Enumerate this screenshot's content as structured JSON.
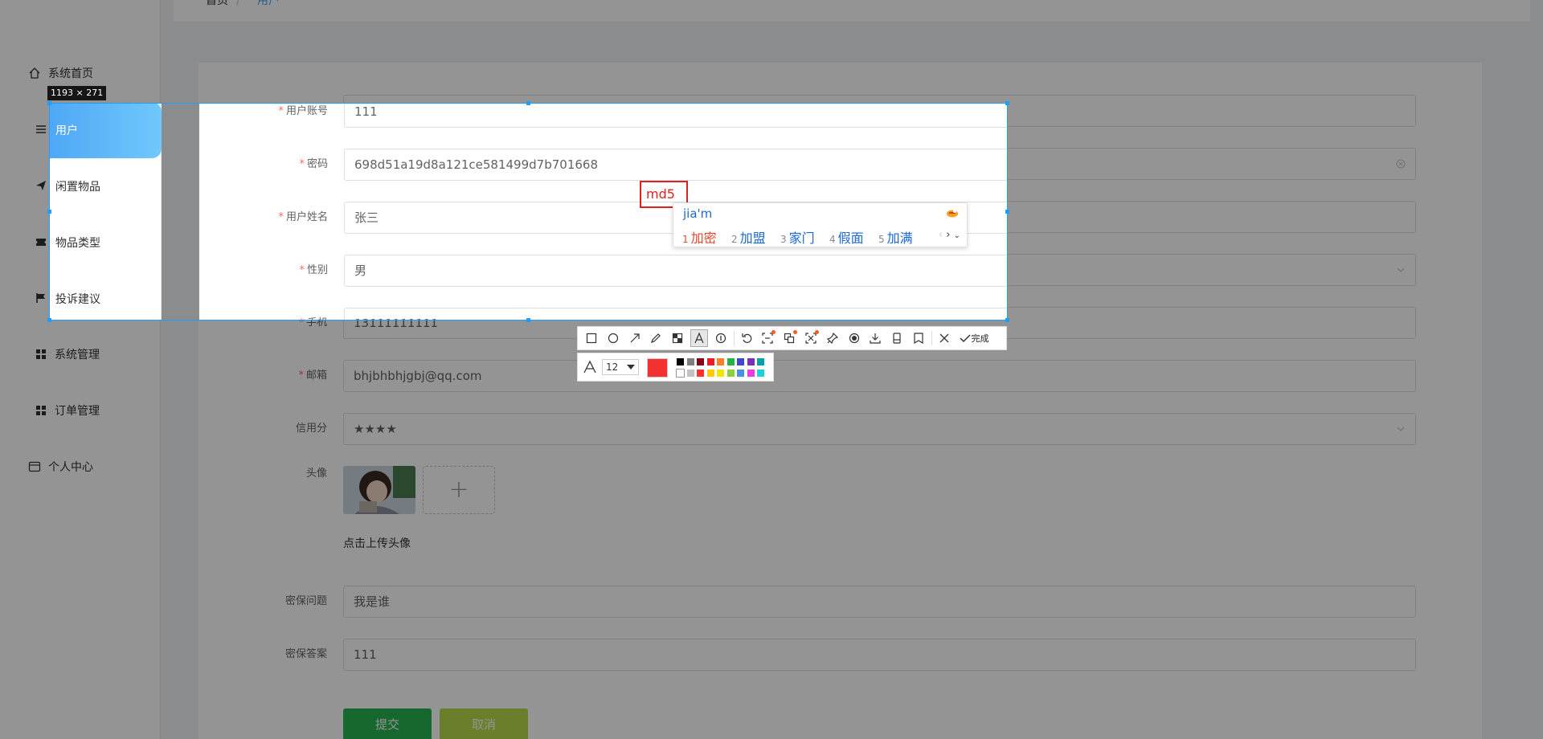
{
  "sidebar": {
    "items": [
      {
        "label": "系统首页",
        "icon": "home-icon"
      },
      {
        "label": "用户",
        "icon": "menu-icon"
      },
      {
        "label": "闲置物品",
        "icon": "send-icon"
      },
      {
        "label": "物品类型",
        "icon": "ticket-icon"
      },
      {
        "label": "投诉建议",
        "icon": "flag-icon"
      },
      {
        "label": "系统管理",
        "icon": "grid-icon"
      },
      {
        "label": "订单管理",
        "icon": "grid-icon"
      },
      {
        "label": "个人中心",
        "icon": "card-icon"
      }
    ]
  },
  "breadcrumb": {
    "home": "首页",
    "separator": "/",
    "current": "用户"
  },
  "form": {
    "fields": [
      {
        "label": "用户账号",
        "required": true,
        "value": "111"
      },
      {
        "label": "密码",
        "required": true,
        "value": "698d51a19d8a121ce581499d7b701668"
      },
      {
        "label": "用户姓名",
        "required": true,
        "value": "张三"
      },
      {
        "label": "性别",
        "required": true,
        "value": "男"
      },
      {
        "label": "手机",
        "required": true,
        "value": "13111111111"
      },
      {
        "label": "邮箱",
        "required": true,
        "value": "bhjbhbhjgbj@qq.com"
      },
      {
        "label": "信用分",
        "required": false,
        "value": "★★★★"
      }
    ],
    "avatar_label": "头像",
    "upload_hint": "点击上传头像",
    "upload_plus": "+",
    "security_question_label": "密保问题",
    "security_question_value": "我是谁",
    "security_answer_label": "密保答案",
    "security_answer_value": "111",
    "submit_label": "提交",
    "cancel_label": "取消"
  },
  "capture": {
    "size_label": "1193 × 271",
    "typed_text": "md5",
    "ime": {
      "input": "jia'm",
      "candidates": [
        {
          "n": "1",
          "text": "加密"
        },
        {
          "n": "2",
          "text": "加盟"
        },
        {
          "n": "3",
          "text": "家门"
        },
        {
          "n": "4",
          "text": "假面"
        },
        {
          "n": "5",
          "text": "加满"
        }
      ]
    },
    "toolbar": {
      "tools": [
        "rectangle-icon",
        "ellipse-icon",
        "arrow-icon",
        "pencil-icon",
        "mosaic-icon",
        "text-icon",
        "number-marker-icon",
        "undo-icon",
        "ocr-icon",
        "translate-icon",
        "scroll-capture-icon",
        "pin-icon",
        "record-icon",
        "download-icon",
        "long-screenshot-icon",
        "save-icon",
        "close-icon"
      ],
      "done_label": "完成"
    },
    "text_options": {
      "font_size": "12",
      "current_color": "#f53030",
      "palette": [
        "#000000",
        "#7f7f7f",
        "#880015",
        "#ed1c24",
        "#ff7f27",
        "#22b14c",
        "#3f48cc",
        "#7b2fbe",
        "#00a2a8",
        "#ffffff",
        "#c3c3c3",
        "#ff3030",
        "#ffc90e",
        "#f2e600",
        "#8ccf3e",
        "#4a90e2",
        "#ee3ae0",
        "#20d0d8"
      ]
    }
  }
}
